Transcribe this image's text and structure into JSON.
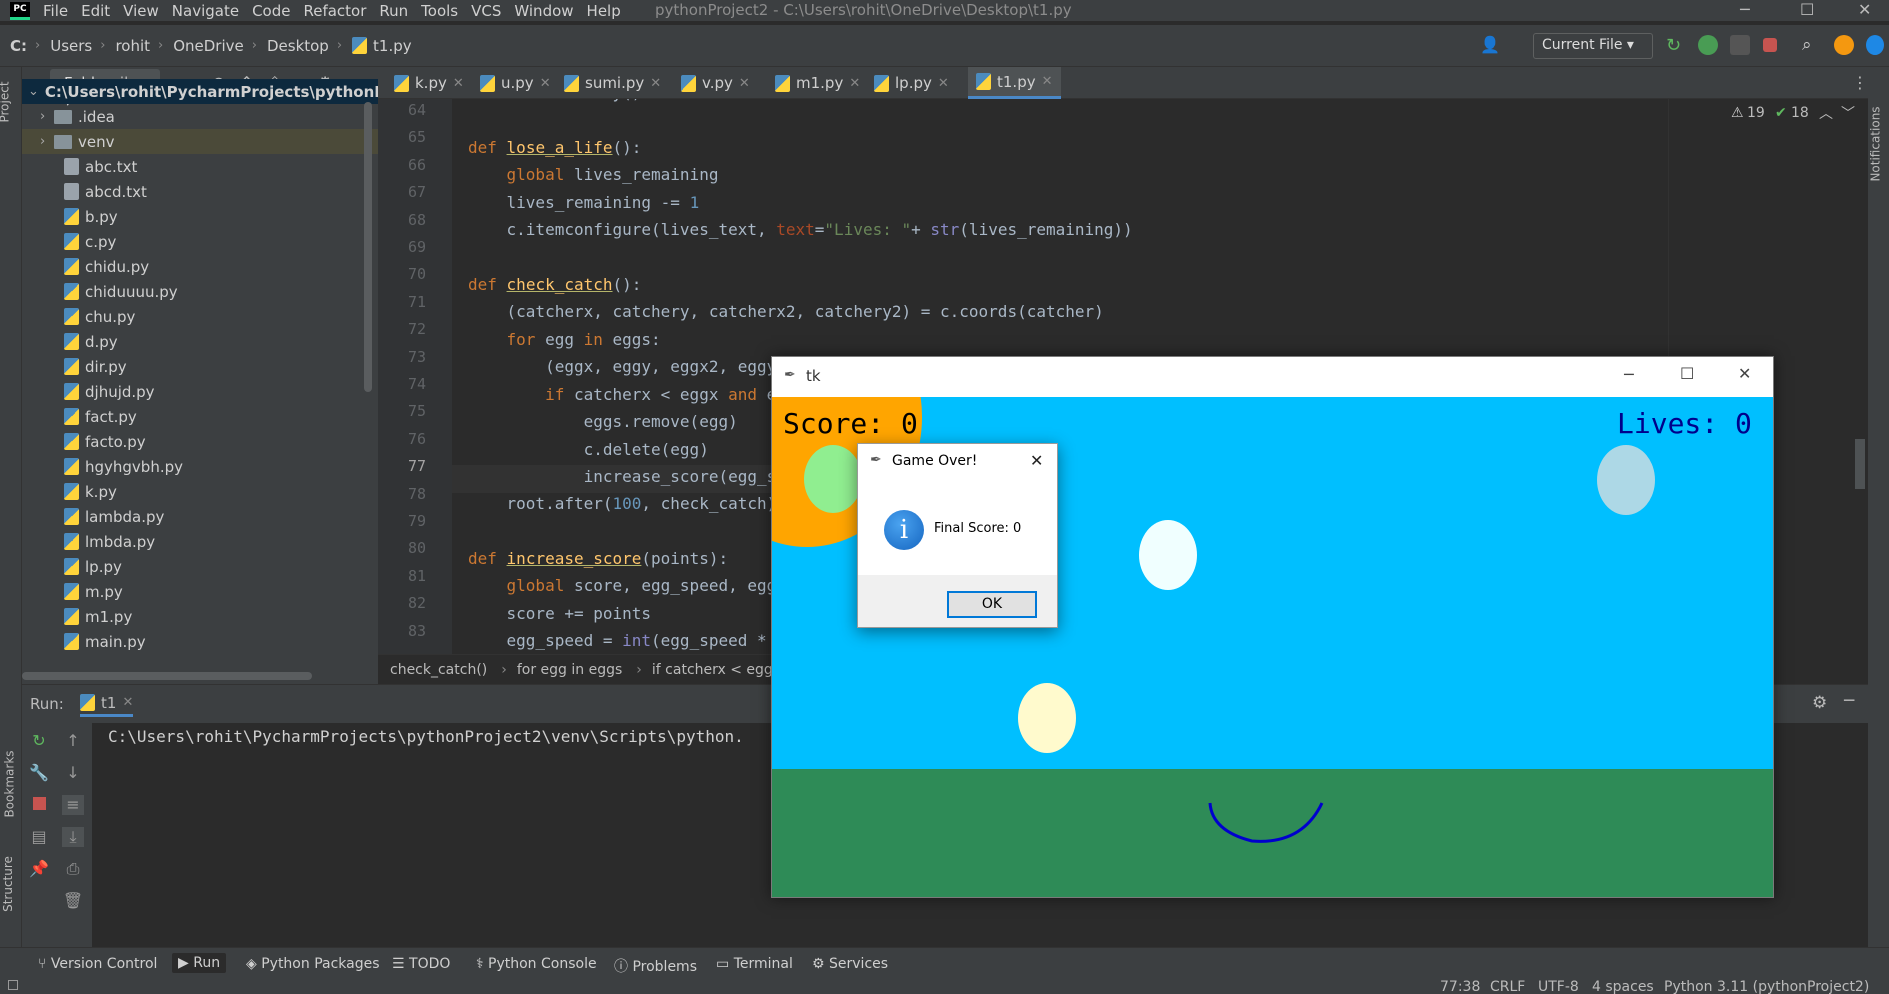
{
  "menu": {
    "logo": "PC",
    "items": [
      "File",
      "Edit",
      "View",
      "Navigate",
      "Code",
      "Refactor",
      "Run",
      "Tools",
      "VCS",
      "Window",
      "Help"
    ],
    "window_title": "pythonProject2 - C:\\Users\\rohit\\OneDrive\\Desktop\\t1.py"
  },
  "nav": {
    "drive": "C:",
    "crumbs": [
      "Users",
      "rohit",
      "OneDrive",
      "Desktop",
      "t1.py"
    ],
    "run_config": "Current File"
  },
  "project": {
    "view_label": "Folder",
    "view_label_suffix": "iles",
    "root": "C:\\Users\\rohit\\PycharmProjects\\pythonPro",
    "items": [
      {
        "name": ".idea",
        "kind": "folder"
      },
      {
        "name": "venv",
        "kind": "folder"
      },
      {
        "name": "abc.txt",
        "kind": "txt"
      },
      {
        "name": "abcd.txt",
        "kind": "txt"
      },
      {
        "name": "b.py",
        "kind": "py"
      },
      {
        "name": "c.py",
        "kind": "py"
      },
      {
        "name": "chidu.py",
        "kind": "py"
      },
      {
        "name": "chiduuuu.py",
        "kind": "py"
      },
      {
        "name": "chu.py",
        "kind": "py"
      },
      {
        "name": "d.py",
        "kind": "py"
      },
      {
        "name": "dir.py",
        "kind": "py"
      },
      {
        "name": "djhujd.py",
        "kind": "py"
      },
      {
        "name": "fact.py",
        "kind": "py"
      },
      {
        "name": "facto.py",
        "kind": "py"
      },
      {
        "name": "hgyhgvbh.py",
        "kind": "py"
      },
      {
        "name": "k.py",
        "kind": "py"
      },
      {
        "name": "lambda.py",
        "kind": "py"
      },
      {
        "name": "lmbda.py",
        "kind": "py"
      },
      {
        "name": "lp.py",
        "kind": "py"
      },
      {
        "name": "m.py",
        "kind": "py"
      },
      {
        "name": "m1.py",
        "kind": "py"
      },
      {
        "name": "main.py",
        "kind": "py"
      }
    ]
  },
  "tabs": [
    "k.py",
    "u.py",
    "sumi.py",
    "v.py",
    "m1.py",
    "lp.py",
    "t1.py"
  ],
  "active_tab": "t1.py",
  "inspections": {
    "warnings": "19",
    "ok": "18"
  },
  "editor_lines": [
    "64",
    "65",
    "66",
    "67",
    "68",
    "69",
    "70",
    "71",
    "72",
    "73",
    "74",
    "75",
    "76",
    "77",
    "78",
    "79",
    "80",
    "81",
    "82",
    "83"
  ],
  "editor_breadcrumb": [
    "check_catch()",
    "for egg in eggs",
    "if catcherx < eggx a"
  ],
  "run": {
    "label": "Run:",
    "config": "t1",
    "output": "C:\\Users\\rohit\\PycharmProjects\\pythonProject2\\venv\\Scripts\\python."
  },
  "bottom_tools": [
    "Version Control",
    "Run",
    "Python Packages",
    "TODO",
    "Python Console",
    "Problems",
    "Terminal",
    "Services"
  ],
  "left_strip": [
    "Project",
    "Bookmarks",
    "Structure"
  ],
  "right_strip": [
    "Notifications"
  ],
  "status": {
    "position": "77:38",
    "line_sep": "CRLF",
    "encoding": "UTF-8",
    "indent": "4 spaces",
    "interpreter": "Python 3.11 (pythonProject2)"
  },
  "tk": {
    "title": "tk",
    "score": "Score: 0",
    "lives": "Lives: 0"
  },
  "dialog": {
    "title": "Game Over!",
    "message": "Final Score: 0",
    "ok": "OK"
  }
}
